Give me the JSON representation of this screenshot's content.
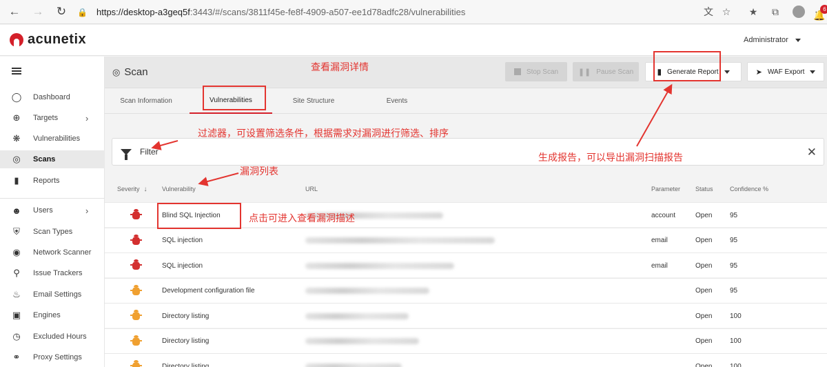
{
  "browser": {
    "url_host": "https://desktop-a3geq5f",
    "url_rest": ":3443/#/scans/3811f45e-fe8f-4909-a507-ee1d78adfc28/vulnerabilities"
  },
  "header": {
    "logo_text": "acunetix",
    "user": "Administrator",
    "notification_count": "6"
  },
  "sidebar": {
    "items": [
      {
        "label": "Dashboard",
        "icon": "gauge-icon"
      },
      {
        "label": "Targets",
        "icon": "target-icon"
      },
      {
        "label": "Vulnerabilities",
        "icon": "bug-icon"
      },
      {
        "label": "Scans",
        "icon": "radar-icon"
      },
      {
        "label": "Reports",
        "icon": "file-icon"
      },
      {
        "label": "Users",
        "icon": "users-icon"
      },
      {
        "label": "Scan Types",
        "icon": "shield-icon"
      },
      {
        "label": "Network Scanner",
        "icon": "network-icon"
      },
      {
        "label": "Issue Trackers",
        "icon": "tracker-icon"
      },
      {
        "label": "Email Settings",
        "icon": "bell-icon"
      },
      {
        "label": "Engines",
        "icon": "chip-icon"
      },
      {
        "label": "Excluded Hours",
        "icon": "clock-icon"
      },
      {
        "label": "Proxy Settings",
        "icon": "globe-icon"
      }
    ]
  },
  "toolbar": {
    "title": "Scan",
    "stop_scan": "Stop Scan",
    "pause_scan": "Pause Scan",
    "generate_report": "Generate Report",
    "waf_export": "WAF Export"
  },
  "tabs": [
    "Scan Information",
    "Vulnerabilities",
    "Site Structure",
    "Events"
  ],
  "filter": {
    "label": "Filter"
  },
  "table": {
    "headers": {
      "severity": "Severity",
      "vulnerability": "Vulnerability",
      "url": "URL",
      "parameter": "Parameter",
      "status": "Status",
      "confidence": "Confidence %"
    },
    "rows": [
      {
        "vulnerability": "Blind SQL Injection",
        "parameter": "account",
        "status": "Open",
        "confidence": "95",
        "severity": "high"
      },
      {
        "vulnerability": "SQL injection",
        "parameter": "email",
        "status": "Open",
        "confidence": "95",
        "severity": "high"
      },
      {
        "vulnerability": "SQL injection",
        "parameter": "email",
        "status": "Open",
        "confidence": "95",
        "severity": "high"
      },
      {
        "vulnerability": "Development configuration file",
        "parameter": "",
        "status": "Open",
        "confidence": "95",
        "severity": "medium"
      },
      {
        "vulnerability": "Directory listing",
        "parameter": "",
        "status": "Open",
        "confidence": "100",
        "severity": "medium"
      },
      {
        "vulnerability": "Directory listing",
        "parameter": "",
        "status": "Open",
        "confidence": "100",
        "severity": "medium"
      },
      {
        "vulnerability": "Directory listing",
        "parameter": "",
        "status": "Open",
        "confidence": "100",
        "severity": "medium"
      }
    ]
  },
  "annotations": {
    "view_details": "查看漏洞详情",
    "filter_note": "过滤器，可设置筛选条件，根据需求对漏洞进行筛选、排序",
    "list_note": "漏洞列表",
    "click_note": "点击可进入查看漏洞描述",
    "report_note": "生成报告，可以导出漏洞扫描报告"
  },
  "colors": {
    "brand_red": "#d4202a",
    "annotation_red": "#e3342f",
    "severity_high": "#d32f2f",
    "severity_medium": "#f0a030"
  }
}
